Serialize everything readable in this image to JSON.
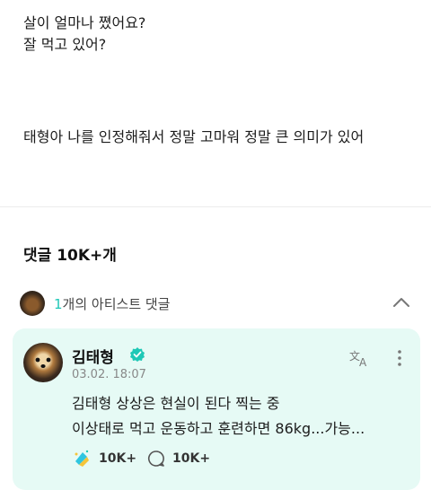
{
  "post": {
    "lines": [
      "살이 얼마나 쪘어요?",
      "잘 먹고 있어?",
      "태형아 나를 인정해줘서 정말 고마워 정말 큰 의미가 있어"
    ]
  },
  "comments": {
    "title": "댓글 10K+개",
    "artist_count": "1",
    "artist_label": "개의 아티스트 댓글"
  },
  "artist_comment": {
    "author": "김태형",
    "date": "03.02. 18:07",
    "lines": [
      "김태형 상상은 현실이 된다 찍는 중",
      "이상태로 먹고 운동하고 훈련하면 86kg...가능..."
    ],
    "likes": "10K+",
    "replies": "10K+"
  },
  "colors": {
    "accent": "#1ec8b6",
    "card_bg": "#e6faf5"
  },
  "icons": [
    "chevron-up-icon",
    "verified-badge-icon",
    "translate-icon",
    "more-vertical-icon",
    "cheer-icon",
    "comment-icon"
  ]
}
